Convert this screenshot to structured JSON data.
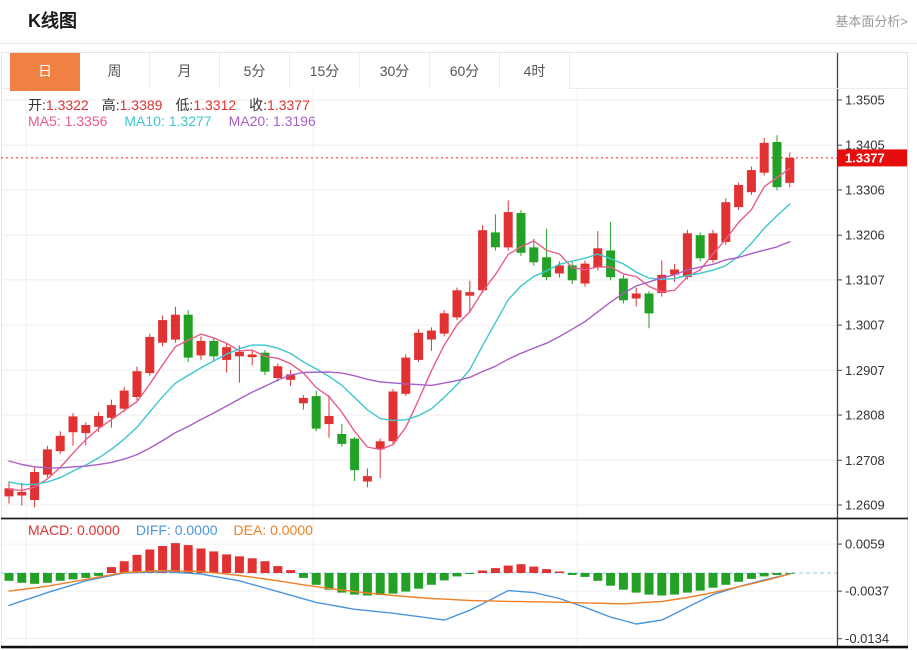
{
  "header": {
    "title": "K线图",
    "link": "基本面分析>"
  },
  "tabs": {
    "items": [
      {
        "key": "day",
        "label": "日",
        "active": true
      },
      {
        "key": "week",
        "label": "周",
        "active": false
      },
      {
        "key": "month",
        "label": "月",
        "active": false
      },
      {
        "key": "5min",
        "label": "5分",
        "active": false
      },
      {
        "key": "15min",
        "label": "15分",
        "active": false
      },
      {
        "key": "30min",
        "label": "30分",
        "active": false
      },
      {
        "key": "60min",
        "label": "60分",
        "active": false
      },
      {
        "key": "4hour",
        "label": "4时",
        "active": false
      }
    ]
  },
  "legend": {
    "ohlc": [
      {
        "label": "开:",
        "value": "1.3322"
      },
      {
        "label": "高:",
        "value": "1.3389"
      },
      {
        "label": "低:",
        "value": "1.3312"
      },
      {
        "label": "收:",
        "value": "1.3377"
      }
    ],
    "ma": [
      {
        "label": "MA5:",
        "value": "1.3356",
        "color": "#e85d8a"
      },
      {
        "label": "MA10:",
        "value": "1.3277",
        "color": "#3ec6ce"
      },
      {
        "label": "MA20:",
        "value": "1.3196",
        "color": "#a85fc8"
      }
    ],
    "macd": [
      {
        "label": "MACD:",
        "value": "0.0000",
        "color": "#e03232"
      },
      {
        "label": "DIFF:",
        "value": "0.0000",
        "color": "#4a96dc"
      },
      {
        "label": "DEA:",
        "value": "0.0000",
        "color": "#ef8126"
      }
    ]
  },
  "chart_data": {
    "type": "candlestick",
    "title": "K线图",
    "legend_position": "top-left",
    "grid": true,
    "price_ylim": [
      1.2609,
      1.3505
    ],
    "macd_ylim": [
      -0.0134,
      0.0059
    ],
    "price_ticks": [
      {
        "label": "1.3505",
        "v": 1.3505
      },
      {
        "label": "1.3405",
        "v": 1.3405
      },
      {
        "label": "1.3306",
        "v": 1.3306
      },
      {
        "label": "1.3206",
        "v": 1.3206
      },
      {
        "label": "1.3107",
        "v": 1.3107
      },
      {
        "label": "1.3007",
        "v": 1.3007
      },
      {
        "label": "1.2907",
        "v": 1.2907
      },
      {
        "label": "1.2808",
        "v": 1.2808
      },
      {
        "label": "1.2708",
        "v": 1.2708
      },
      {
        "label": "1.2609",
        "v": 1.2609
      }
    ],
    "macd_ticks": [
      {
        "label": "0.0059",
        "v": 0.0059
      },
      {
        "label": "-0.0037",
        "v": -0.0037
      },
      {
        "label": "-0.0134",
        "v": -0.0134
      }
    ],
    "last_price": {
      "label": "1.3377",
      "v": 1.3377
    },
    "ma_periods": [
      5,
      10,
      20
    ],
    "prior_closes": [
      1.28,
      1.2792,
      1.2784,
      1.2776,
      1.2768,
      1.276,
      1.275,
      1.274,
      1.273,
      1.2718,
      1.2706,
      1.2694,
      1.2684,
      1.2676,
      1.2668,
      1.266,
      1.2652,
      1.2646,
      1.264,
      1.2636
    ],
    "candles": [
      [
        1.2628,
        1.2661,
        1.2612,
        1.2646
      ],
      [
        1.263,
        1.2658,
        1.2608,
        1.2638
      ],
      [
        1.262,
        1.2692,
        1.2604,
        1.2682
      ],
      [
        1.2676,
        1.274,
        1.267,
        1.2732
      ],
      [
        1.2728,
        1.2772,
        1.2722,
        1.2762
      ],
      [
        1.277,
        1.2812,
        1.274,
        1.2805
      ],
      [
        1.2768,
        1.2792,
        1.2741,
        1.2786
      ],
      [
        1.2782,
        1.2815,
        1.277,
        1.2806
      ],
      [
        1.2802,
        1.2842,
        1.278,
        1.283
      ],
      [
        1.2822,
        1.287,
        1.2815,
        1.2862
      ],
      [
        1.2848,
        1.2915,
        1.284,
        1.2905
      ],
      [
        1.2901,
        1.2988,
        1.2895,
        1.2981
      ],
      [
        1.2968,
        1.3028,
        1.296,
        1.3018
      ],
      [
        1.2975,
        1.3048,
        1.2968,
        1.303
      ],
      [
        1.303,
        1.304,
        1.2925,
        1.2935
      ],
      [
        1.294,
        1.2982,
        1.293,
        1.2972
      ],
      [
        1.2972,
        1.298,
        1.2928,
        1.2938
      ],
      [
        1.293,
        1.2968,
        1.2902,
        1.2958
      ],
      [
        1.2938,
        1.2962,
        1.288,
        1.2948
      ],
      [
        1.2936,
        1.2952,
        1.2918,
        1.2942
      ],
      [
        1.2946,
        1.2952,
        1.2896,
        1.2904
      ],
      [
        1.289,
        1.2922,
        1.2882,
        1.2916
      ],
      [
        1.2886,
        1.2908,
        1.2872,
        1.2898
      ],
      [
        1.2834,
        1.2852,
        1.282,
        1.2846
      ],
      [
        1.285,
        1.2862,
        1.2772,
        1.2778
      ],
      [
        1.2788,
        1.2852,
        1.2758,
        1.2806
      ],
      [
        1.2766,
        1.2788,
        1.2738,
        1.2744
      ],
      [
        1.2756,
        1.276,
        1.2662,
        1.2686
      ],
      [
        1.2661,
        1.269,
        1.2648,
        1.2673
      ],
      [
        1.2732,
        1.2756,
        1.2668,
        1.275
      ],
      [
        1.275,
        1.2866,
        1.2744,
        1.286
      ],
      [
        1.2855,
        1.2942,
        1.285,
        1.2935
      ],
      [
        1.293,
        1.2998,
        1.2925,
        1.299
      ],
      [
        1.2975,
        1.3002,
        1.295,
        1.2995
      ],
      [
        1.2988,
        1.304,
        1.2982,
        1.3033
      ],
      [
        1.3024,
        1.309,
        1.3018,
        1.3084
      ],
      [
        1.3072,
        1.3105,
        1.3035,
        1.308
      ],
      [
        1.3084,
        1.3228,
        1.3078,
        1.3217
      ],
      [
        1.3212,
        1.3252,
        1.3172,
        1.3179
      ],
      [
        1.3179,
        1.3283,
        1.3172,
        1.3257
      ],
      [
        1.3255,
        1.3262,
        1.316,
        1.3167
      ],
      [
        1.3179,
        1.3198,
        1.3138,
        1.3146
      ],
      [
        1.3157,
        1.322,
        1.3106,
        1.3113
      ],
      [
        1.3121,
        1.3148,
        1.3112,
        1.3139
      ],
      [
        1.3139,
        1.3148,
        1.3098,
        1.3106
      ],
      [
        1.3099,
        1.315,
        1.3092,
        1.3143
      ],
      [
        1.3135,
        1.3215,
        1.3128,
        1.3177
      ],
      [
        1.3172,
        1.3235,
        1.3106,
        1.3113
      ],
      [
        1.311,
        1.3118,
        1.3055,
        1.3062
      ],
      [
        1.3066,
        1.309,
        1.3048,
        1.3077
      ],
      [
        1.3077,
        1.3082,
        1.3,
        1.3033
      ],
      [
        1.3078,
        1.315,
        1.307,
        1.3118
      ],
      [
        1.3119,
        1.3142,
        1.3102,
        1.313
      ],
      [
        1.3113,
        1.3218,
        1.3108,
        1.321
      ],
      [
        1.3206,
        1.3212,
        1.3148,
        1.3155
      ],
      [
        1.3151,
        1.3218,
        1.3145,
        1.321
      ],
      [
        1.3191,
        1.3288,
        1.3185,
        1.3279
      ],
      [
        1.3268,
        1.3322,
        1.3262,
        1.3317
      ],
      [
        1.3301,
        1.3358,
        1.3295,
        1.335
      ],
      [
        1.3344,
        1.3421,
        1.3338,
        1.341
      ],
      [
        1.3412,
        1.3427,
        1.3305,
        1.3312
      ],
      [
        1.3322,
        1.3389,
        1.3312,
        1.3377
      ]
    ],
    "macd": {
      "hist": [
        -0.0016,
        -0.002,
        -0.0022,
        -0.002,
        -0.0016,
        -0.0013,
        -0.001,
        -0.0006,
        0.0012,
        0.0024,
        0.0037,
        0.0048,
        0.0055,
        0.0061,
        0.0057,
        0.005,
        0.0044,
        0.0038,
        0.0034,
        0.003,
        0.0024,
        0.0014,
        0.0006,
        -0.001,
        -0.0024,
        -0.0034,
        -0.004,
        -0.0044,
        -0.0046,
        -0.0045,
        -0.0042,
        -0.0038,
        -0.0032,
        -0.0024,
        -0.0015,
        -0.0007,
        -0.0002,
        0.0005,
        0.001,
        0.0015,
        0.0018,
        0.0013,
        0.0008,
        0.0003,
        -0.0004,
        -0.0008,
        -0.0016,
        -0.0026,
        -0.0034,
        -0.004,
        -0.0044,
        -0.0046,
        -0.0044,
        -0.004,
        -0.0036,
        -0.003,
        -0.0024,
        -0.0018,
        -0.0012,
        -0.0007,
        -0.0004,
        -0.0001
      ],
      "diff_points": [
        [
          0,
          -0.0066
        ],
        [
          3,
          -0.004
        ],
        [
          6,
          -0.0016
        ],
        [
          9,
          0.0
        ],
        [
          12,
          0.0003
        ],
        [
          15,
          -0.0002
        ],
        [
          18,
          -0.0016
        ],
        [
          21,
          -0.0038
        ],
        [
          24,
          -0.006
        ],
        [
          27,
          -0.0074
        ],
        [
          30,
          -0.0082
        ],
        [
          34,
          -0.0096
        ],
        [
          36,
          -0.0076
        ],
        [
          39,
          -0.0036
        ],
        [
          41,
          -0.004
        ],
        [
          43,
          -0.0052
        ],
        [
          45,
          -0.007
        ],
        [
          47,
          -0.009
        ],
        [
          49,
          -0.0104
        ],
        [
          51,
          -0.0096
        ],
        [
          53,
          -0.007
        ],
        [
          55,
          -0.0044
        ],
        [
          57,
          -0.0028
        ],
        [
          59,
          -0.0014
        ],
        [
          61,
          -0.0002
        ]
      ],
      "dea_points": [
        [
          0,
          -0.0037
        ],
        [
          3,
          -0.0027
        ],
        [
          6,
          -0.0013
        ],
        [
          9,
          0.0001
        ],
        [
          12,
          0.0005
        ],
        [
          15,
          0.0003
        ],
        [
          18,
          -0.0005
        ],
        [
          21,
          -0.0016
        ],
        [
          24,
          -0.0028
        ],
        [
          27,
          -0.0038
        ],
        [
          30,
          -0.0046
        ],
        [
          33,
          -0.0052
        ],
        [
          36,
          -0.0056
        ],
        [
          39,
          -0.0058
        ],
        [
          42,
          -0.0059
        ],
        [
          45,
          -0.0061
        ],
        [
          48,
          -0.0063
        ],
        [
          51,
          -0.0058
        ],
        [
          53,
          -0.005
        ],
        [
          55,
          -0.004
        ],
        [
          57,
          -0.0028
        ],
        [
          59,
          -0.0016
        ],
        [
          61,
          -0.0002
        ]
      ]
    },
    "colors": {
      "up": "#e03232",
      "down": "#23a126",
      "ma5": "#e85d8a",
      "ma10": "#3ec6ce",
      "ma20": "#a85fc8",
      "diff": "#4a96dc",
      "dea": "#ef8126",
      "grid": "#ededed",
      "axis": "#444444",
      "tick_label": "#333333",
      "last_price_line": "#ee2222",
      "last_price_bg": "#e60d0d",
      "zero_dash": "#8ecbe8",
      "tab_active_bg": "#ef8243"
    }
  }
}
